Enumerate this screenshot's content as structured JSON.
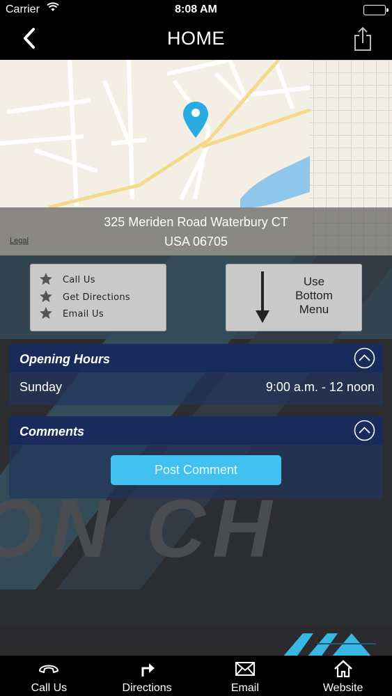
{
  "status_bar": {
    "carrier": "Carrier",
    "time": "8:08 AM"
  },
  "nav": {
    "title": "HOME"
  },
  "map": {
    "address_line1": "325 Meriden Road Waterbury CT",
    "address_line2": "USA 06705",
    "legal": "Legal",
    "pin_color": "#29abe2"
  },
  "quick_actions": [
    {
      "label": "Call Us"
    },
    {
      "label": "Get Directions"
    },
    {
      "label": "Email Us"
    }
  ],
  "bottom_menu_hint": {
    "line1": "Use",
    "line2": "Bottom",
    "line3": "Menu"
  },
  "opening_hours": {
    "title": "Opening Hours",
    "rows": [
      {
        "day": "Sunday",
        "hours": "9:00 a.m. - 12 noon"
      }
    ]
  },
  "comments": {
    "title": "Comments",
    "post_label": "Post Comment"
  },
  "tabbar": [
    {
      "label": "Call Us",
      "icon": "phone-icon"
    },
    {
      "label": "Directions",
      "icon": "directions-icon"
    },
    {
      "label": "Email",
      "icon": "email-icon"
    },
    {
      "label": "Website",
      "icon": "home-icon"
    }
  ],
  "colors": {
    "accent": "#40c1ef",
    "panel_header": "#182a5c",
    "tabbar": "#000000"
  }
}
